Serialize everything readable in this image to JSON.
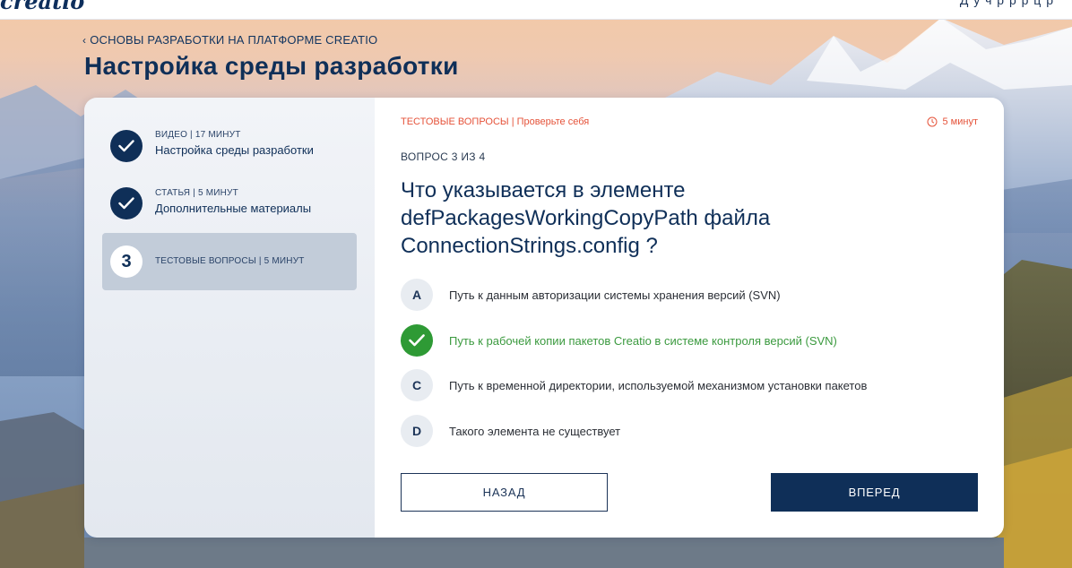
{
  "header": {
    "logo": "creatio",
    "nav_fragment": "Д  у  ч  р  р  р  ц  р"
  },
  "breadcrumb": {
    "chevron_icon": "chevron-left-icon",
    "label": "ОСНОВЫ РАЗРАБОТКИ НА ПЛАТФОРМЕ CREATIO"
  },
  "page_title": "Настройка среды разработки",
  "sidebar": {
    "steps": [
      {
        "state": "done",
        "kind": "ВИДЕО | 17 МИНУТ",
        "name": "Настройка среды разработки",
        "icon": "check-icon"
      },
      {
        "state": "done",
        "kind": "СТАТЬЯ | 5 МИНУТ",
        "name": "Дополнительные материалы",
        "icon": "check-icon"
      },
      {
        "state": "active",
        "number": "3",
        "kind": "ТЕСТОВЫЕ ВОПРОСЫ | 5 МИНУТ",
        "name": ""
      }
    ]
  },
  "quiz": {
    "section_tag": "ТЕСТОВЫЕ ВОПРОСЫ",
    "section_sep": "|",
    "section_hint": "Проверьте себя",
    "timer_icon": "clock-icon",
    "timer": "5 минут",
    "counter": "ВОПРОС 3 ИЗ 4",
    "question": "Что указывается в элементе defPackagesWorkingCopyPath файла ConnectionStrings.config ?",
    "answers": [
      {
        "letter": "A",
        "text": "Путь к данным авторизации системы хранения версий (SVN)",
        "correct": false
      },
      {
        "letter": "",
        "text": "Путь к рабочей копии пакетов Creatio в системе контроля версий (SVN)",
        "correct": true
      },
      {
        "letter": "C",
        "text": "Путь к временной директории, используемой механизмом установки пакетов",
        "correct": false
      },
      {
        "letter": "D",
        "text": "Такого элемента не существует",
        "correct": false
      }
    ],
    "back_label": "НАЗАД",
    "next_label": "ВПЕРЕД"
  },
  "colors": {
    "navy": "#0f2f58",
    "accent_red": "#e5533a",
    "correct_green": "#2e9a35",
    "active_step_bg": "#c2ccd9"
  }
}
